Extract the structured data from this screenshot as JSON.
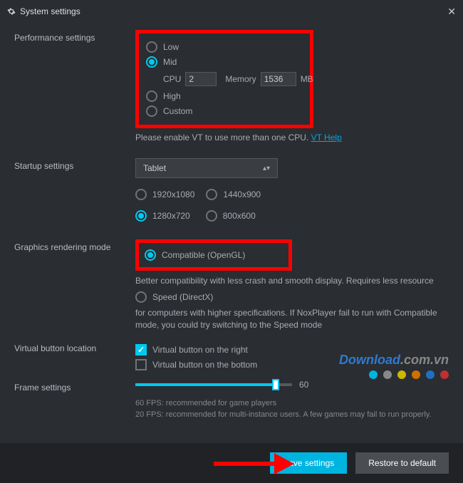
{
  "title": "System settings",
  "performance": {
    "label": "Performance settings",
    "low": "Low",
    "mid": "Mid",
    "cpu_label": "CPU",
    "cpu_value": "2",
    "mem_label": "Memory",
    "mem_value": "1536",
    "mem_unit": "MB",
    "high": "High",
    "custom": "Custom",
    "vt_hint": "Please enable VT to use more than one CPU.",
    "vt_link": "VT Help"
  },
  "startup": {
    "label": "Startup settings",
    "selected": "Tablet",
    "res1": "1920x1080",
    "res2": "1440x900",
    "res3": "1280x720",
    "res4": "800x600"
  },
  "graphics": {
    "label": "Graphics rendering mode",
    "compat": "Compatible (OpenGL)",
    "compat_desc": "Better compatibility with less crash and smooth display. Requires less resource",
    "speed": "Speed (DirectX)",
    "speed_desc": "for computers with higher specifications. If NoxPlayer fail to run with Compatible mode, you could try switching to the Speed mode"
  },
  "virtual": {
    "label": "Virtual button location",
    "right": "Virtual button on the right",
    "bottom": "Virtual button on the bottom"
  },
  "frame": {
    "label": "Frame settings",
    "value": "60",
    "note1": "60 FPS: recommended for game players",
    "note2": "20 FPS: recommended for multi-instance users. A few games may fail to run properly."
  },
  "footer": {
    "save": "Save settings",
    "restore": "Restore to default"
  },
  "watermark": {
    "text1": "Download",
    "text2": ".com.vn"
  },
  "dot_colors": [
    "#00b4e0",
    "#888888",
    "#c9b800",
    "#d07000",
    "#2070c0",
    "#c03030"
  ]
}
